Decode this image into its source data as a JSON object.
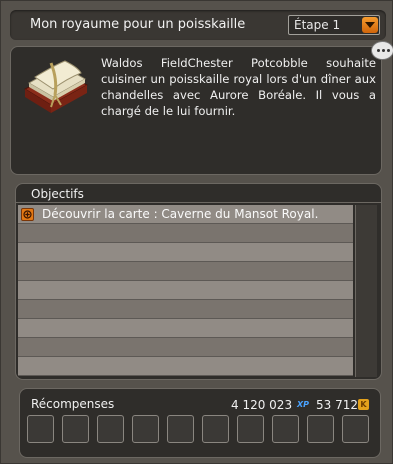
{
  "header": {
    "title": "Mon royaume pour un poisskaille",
    "step_select": "Étape 1"
  },
  "description": {
    "text": "Waldos FieldChester Potcobble souhaite cuisiner un poisskaille royal lors d'un dîner aux chandelles avec Aurore Boréale. Il vous a chargé de le lui fournir.",
    "icon": "quest-book-icon",
    "more_icon": "more-options-icon"
  },
  "objectives": {
    "title": "Objectifs",
    "items": [
      {
        "text": "Découvrir la carte : Caverne du Mansot Royal.",
        "icon": "objective-flag-icon"
      }
    ]
  },
  "rewards": {
    "title": "Récompenses",
    "xp": "4 120 023",
    "xp_label": "XP",
    "kamas": "53 712",
    "kamas_label": "K",
    "slot_count": 10
  },
  "colors": {
    "accent": "#e37813",
    "xp": "#4aa3ff",
    "kamas": "#e3a11c"
  }
}
